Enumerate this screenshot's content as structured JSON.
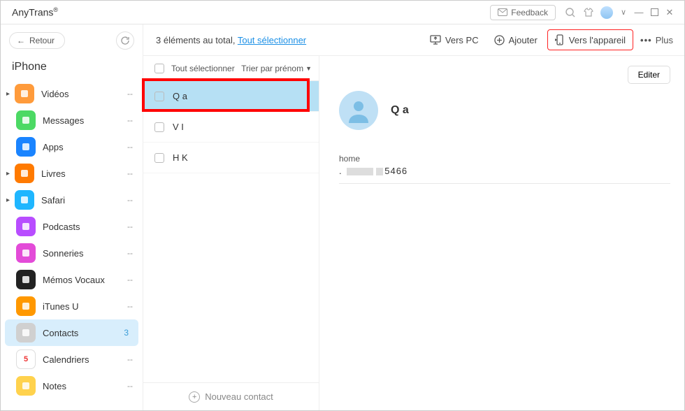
{
  "title": "AnyTrans",
  "titlebar": {
    "feedback": "Feedback"
  },
  "sidebar": {
    "back": "Retour",
    "device": "iPhone",
    "items": [
      {
        "label": "Vidéos",
        "count": "--",
        "color": "#ff9b3b",
        "expandable": true,
        "icon": "videos"
      },
      {
        "label": "Messages",
        "count": "--",
        "color": "#4cd964",
        "icon": "chat"
      },
      {
        "label": "Apps",
        "count": "--",
        "color": "#1a84ff",
        "icon": "app"
      },
      {
        "label": "Livres",
        "count": "--",
        "color": "#ff7a00",
        "expandable": true,
        "icon": "books"
      },
      {
        "label": "Safari",
        "count": "--",
        "color": "#1fb6ff",
        "expandable": true,
        "icon": "safari"
      },
      {
        "label": "Podcasts",
        "count": "--",
        "color": "#b84dff",
        "icon": "podcast"
      },
      {
        "label": "Sonneries",
        "count": "--",
        "color": "#e34bd8",
        "icon": "bell"
      },
      {
        "label": "Mémos Vocaux",
        "count": "--",
        "color": "#222",
        "icon": "voice"
      },
      {
        "label": "iTunes U",
        "count": "--",
        "color": "#ff9800",
        "icon": "grad"
      },
      {
        "label": "Contacts",
        "count": "3",
        "color": "#d0d0d0",
        "active": true,
        "icon": "contacts"
      },
      {
        "label": "Calendriers",
        "count": "--",
        "color": "#fff",
        "icon": "cal",
        "text": "5"
      },
      {
        "label": "Notes",
        "count": "--",
        "color": "#ffd24d",
        "icon": "notes"
      }
    ]
  },
  "toolbar": {
    "total": "3 éléments au total, ",
    "select_all": "Tout sélectionner",
    "to_pc": "Vers PC",
    "add": "Ajouter",
    "to_device": "Vers l'appareil",
    "more": "Plus"
  },
  "list": {
    "select_all": "Tout sélectionner",
    "sort": "Trier par prénom",
    "rows": [
      {
        "name": "Q a",
        "selected": true
      },
      {
        "name": "V I"
      },
      {
        "name": "H K"
      }
    ],
    "new": "Nouveau contact"
  },
  "detail": {
    "edit": "Editer",
    "name": "Q a",
    "fields": [
      {
        "label": "home",
        "value_suffix": "5466"
      }
    ]
  }
}
